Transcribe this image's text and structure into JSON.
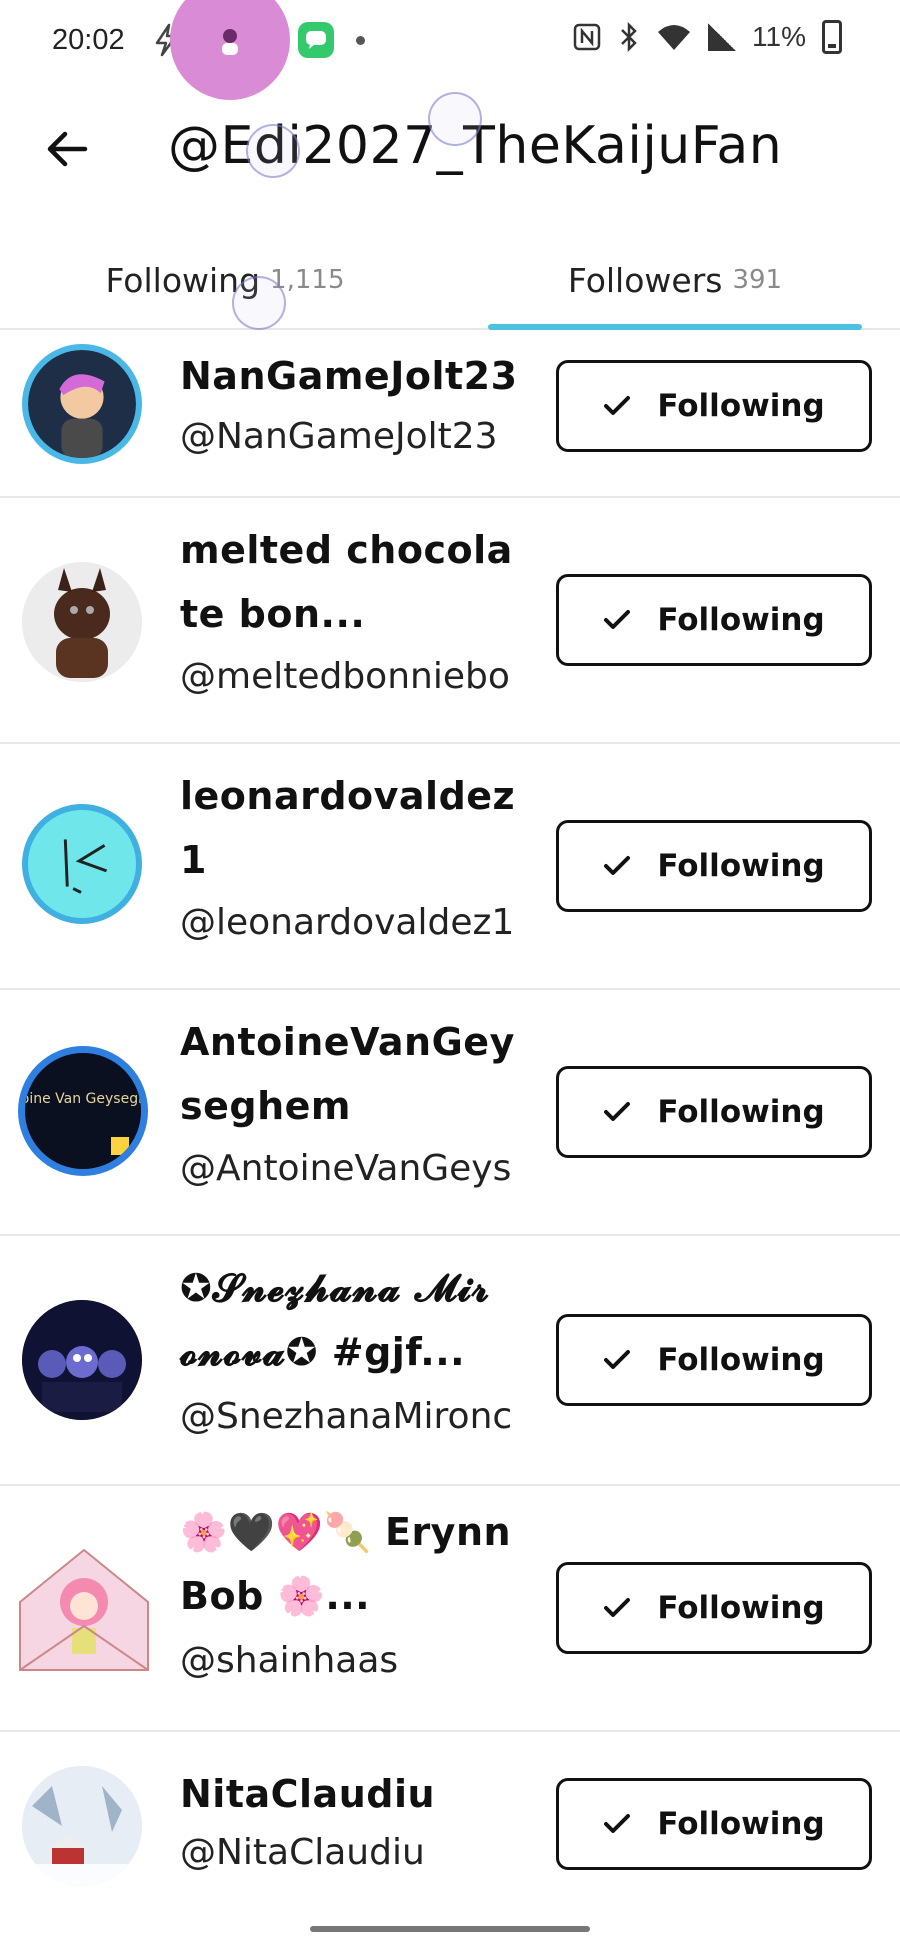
{
  "status_bar": {
    "time": "20:02",
    "battery": "11%",
    "icons_left": [
      "avatar-app-icon",
      "lightning-icon",
      "capcut-icon",
      "settings-app-icon",
      "messages-icon"
    ],
    "icons_right": [
      "nfc-icon",
      "bluetooth-icon",
      "wifi-icon",
      "signal-icon",
      "battery-icon"
    ]
  },
  "header": {
    "title": "@Edi2027_TheKaijuFan",
    "back_icon": "arrow-left-icon"
  },
  "tabs": [
    {
      "label": "Following",
      "count": "1,115",
      "active": false
    },
    {
      "label": "Followers",
      "count": "391",
      "active": true
    }
  ],
  "colors": {
    "accent": "#4cc2e0",
    "divider": "#e8e8e8",
    "text": "#111111"
  },
  "users": [
    {
      "display_name": "NanGameJolt23",
      "handle": "@NanGameJolt23",
      "button": "Following"
    },
    {
      "display_name": "melted chocolate bon...",
      "handle": "@meltedbonniebo",
      "button": "Following"
    },
    {
      "display_name": "leonardovaldez 1",
      "handle": "@leonardovaldez1",
      "button": "Following"
    },
    {
      "display_name": "AntoineVanGey seghem",
      "handle": "@AntoineVanGeys",
      "button": "Following",
      "avatar_text": "Antoine Van Geyseghem"
    },
    {
      "display_name": "✪𝓢𝓷𝓮𝔃𝓱𝓪𝓷𝓪 𝓜𝓲𝓻𝓸𝓷𝓸𝓿𝓪✪ #gjf...",
      "handle": "@SnezhanaMironc",
      "button": "Following"
    },
    {
      "display_name": "🌸🖤💖🍡 ErynnBob 🌸...",
      "handle": "@shainhaas",
      "button": "Following"
    },
    {
      "display_name": "NitaClaudiu",
      "handle": "@NitaClaudiu",
      "button": "Following"
    }
  ]
}
